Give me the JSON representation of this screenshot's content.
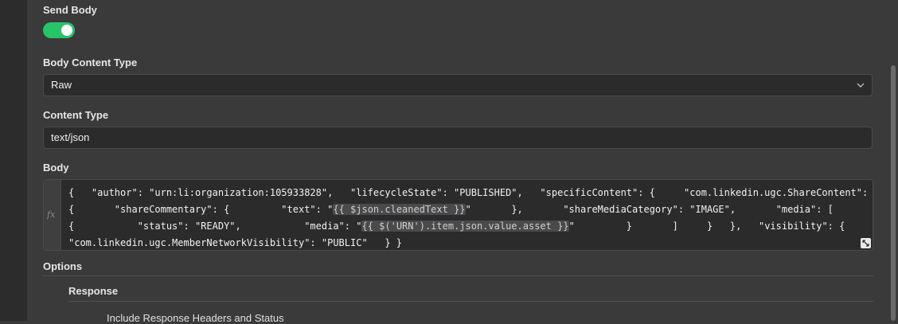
{
  "send_body": {
    "label": "Send Body",
    "enabled": true,
    "accent": "#29c36a"
  },
  "body_content_type": {
    "label": "Body Content Type",
    "value": "Raw"
  },
  "content_type": {
    "label": "Content Type",
    "value": "text/json"
  },
  "body": {
    "label": "Body",
    "gutter_icon": "fx",
    "segments": [
      {
        "text": "{   \"author\": \"urn:li:organization:105933828\",   \"lifecycleState\": \"PUBLISHED\",   \"specificContent\": {     \"com.linkedin.ugc.ShareContent\": {       \"shareCommentary\": {         \"text\": \"",
        "expr": false
      },
      {
        "text": "{{ $json.cleanedText }}",
        "expr": true
      },
      {
        "text": "\"       },       \"shareMediaCategory\": \"IMAGE\",       \"media\": [         {           \"status\": \"READY\",           \"media\": \"",
        "expr": false
      },
      {
        "text": "{{ $('URN').item.json.value.asset }}",
        "expr": true
      },
      {
        "text": "\"         }       ]     }   },   \"visibility\": {     \"com.linkedin.ugc.MemberNetworkVisibility\": \"PUBLIC\"   } }",
        "expr": false
      }
    ]
  },
  "options": {
    "label": "Options",
    "response": {
      "label": "Response",
      "items": [
        "Include Response Headers and Status"
      ]
    }
  }
}
